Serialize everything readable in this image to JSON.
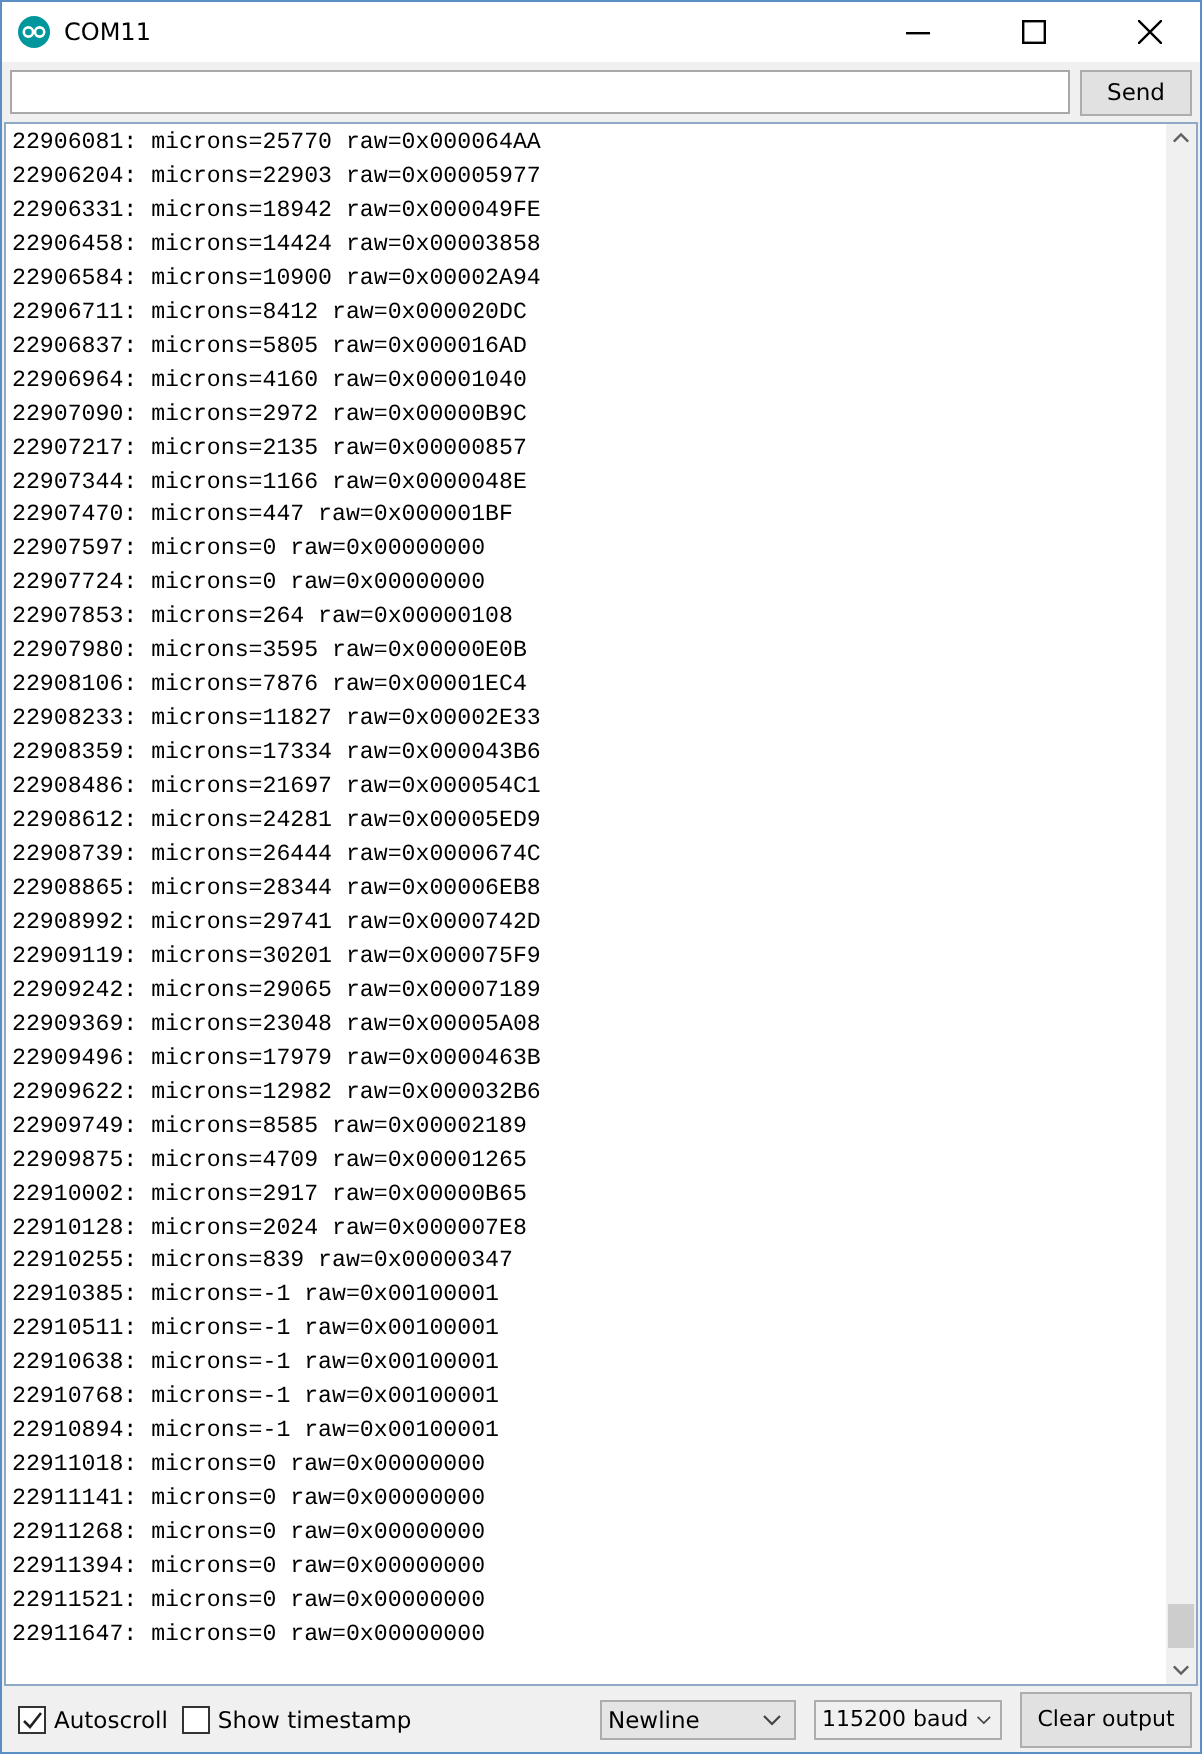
{
  "window": {
    "title": "COM11"
  },
  "send_button": "Send",
  "output_lines": [
    "22906081: microns=25770 raw=0x000064AA",
    "22906204: microns=22903 raw=0x00005977",
    "22906331: microns=18942 raw=0x000049FE",
    "22906458: microns=14424 raw=0x00003858",
    "22906584: microns=10900 raw=0x00002A94",
    "22906711: microns=8412 raw=0x000020DC",
    "22906837: microns=5805 raw=0x000016AD",
    "22906964: microns=4160 raw=0x00001040",
    "22907090: microns=2972 raw=0x00000B9C",
    "22907217: microns=2135 raw=0x00000857",
    "22907344: microns=1166 raw=0x0000048E",
    "22907470: microns=447 raw=0x000001BF",
    "22907597: microns=0 raw=0x00000000",
    "22907724: microns=0 raw=0x00000000",
    "22907853: microns=264 raw=0x00000108",
    "22907980: microns=3595 raw=0x00000E0B",
    "22908106: microns=7876 raw=0x00001EC4",
    "22908233: microns=11827 raw=0x00002E33",
    "22908359: microns=17334 raw=0x000043B6",
    "22908486: microns=21697 raw=0x000054C1",
    "22908612: microns=24281 raw=0x00005ED9",
    "22908739: microns=26444 raw=0x0000674C",
    "22908865: microns=28344 raw=0x00006EB8",
    "22908992: microns=29741 raw=0x0000742D",
    "22909119: microns=30201 raw=0x000075F9",
    "22909242: microns=29065 raw=0x00007189",
    "22909369: microns=23048 raw=0x00005A08",
    "22909496: microns=17979 raw=0x0000463B",
    "22909622: microns=12982 raw=0x000032B6",
    "22909749: microns=8585 raw=0x00002189",
    "22909875: microns=4709 raw=0x00001265",
    "22910002: microns=2917 raw=0x00000B65",
    "22910128: microns=2024 raw=0x000007E8",
    "22910255: microns=839 raw=0x00000347",
    "22910385: microns=-1 raw=0x00100001",
    "22910511: microns=-1 raw=0x00100001",
    "22910638: microns=-1 raw=0x00100001",
    "22910768: microns=-1 raw=0x00100001",
    "22910894: microns=-1 raw=0x00100001",
    "22911018: microns=0 raw=0x00000000",
    "22911141: microns=0 raw=0x00000000",
    "22911268: microns=0 raw=0x00000000",
    "22911394: microns=0 raw=0x00000000",
    "22911521: microns=0 raw=0x00000000",
    "22911647: microns=0 raw=0x00000000"
  ],
  "options": [
    {
      "label": "Autoscroll",
      "checked": true
    },
    {
      "label": "Show timestamp",
      "checked": false
    }
  ],
  "line_ending": "Newline",
  "baud_rate": "115200 baud",
  "clear_button": "Clear output"
}
